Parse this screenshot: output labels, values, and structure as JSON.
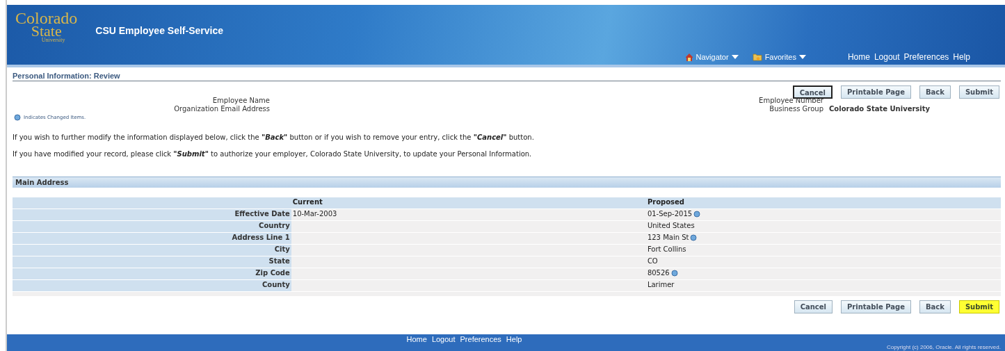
{
  "header": {
    "logo": [
      "Colorado",
      "State",
      "University"
    ],
    "title": "CSU Employee Self-Service",
    "menus": [
      {
        "label": "Navigator",
        "kind": "house"
      },
      {
        "label": "Favorites",
        "kind": "folder"
      }
    ],
    "links": [
      "Home",
      "Logout",
      "Preferences",
      "Help"
    ]
  },
  "page_title": "Personal Information: Review",
  "buttons_top": [
    {
      "label": "Cancel",
      "focused": true,
      "highlighted": false
    },
    {
      "label": "Printable Page",
      "focused": false,
      "highlighted": false
    },
    {
      "label": "Back",
      "focused": false,
      "highlighted": false
    },
    {
      "label": "Submit",
      "focused": false,
      "highlighted": false
    }
  ],
  "info_left": [
    {
      "label": "Employee Name"
    },
    {
      "label": "Organization Email Address"
    }
  ],
  "info_right": [
    {
      "label": "Employee Number"
    },
    {
      "label": "Business Group",
      "value": "Colorado State University"
    }
  ],
  "legend": "Indicates Changed Items.",
  "paragraphs": [
    "If you wish to further modify the information displayed below, click the **\"Back\"** button or if you wish to remove your entry, click the **\"Cancel\"** button.",
    "If you have modified your record, please click **\"Submit\"** to authorize your employer, Colorado State University, to update your Personal Information."
  ],
  "section": {
    "title": "Main Address",
    "columns": [
      "Current",
      "Proposed"
    ],
    "rows": [
      {
        "label": "Effective Date",
        "current": "10-Mar-2003",
        "proposed": "01-Sep-2015",
        "changed": true
      },
      {
        "label": "Country",
        "proposed": "United States",
        "changed": false
      },
      {
        "label": "Address Line 1",
        "proposed": "123 Main St",
        "changed": true
      },
      {
        "label": "City",
        "proposed": "Fort Collins",
        "changed": false
      },
      {
        "label": "State",
        "proposed": "CO",
        "changed": false
      },
      {
        "label": "Zip Code",
        "proposed": "80526",
        "changed": true
      },
      {
        "label": "County",
        "proposed": "Larimer",
        "changed": false
      }
    ]
  },
  "buttons_bottom": [
    {
      "label": "Cancel",
      "focused": false,
      "highlighted": false
    },
    {
      "label": "Printable Page",
      "focused": false,
      "highlighted": false
    },
    {
      "label": "Back",
      "focused": false,
      "highlighted": false
    },
    {
      "label": "Submit",
      "focused": false,
      "highlighted": true
    }
  ],
  "footer": {
    "links": [
      "Home",
      "Logout",
      "Preferences",
      "Help"
    ],
    "copyright": "Copyright (c) 2006, Oracle. All rights reserved."
  }
}
